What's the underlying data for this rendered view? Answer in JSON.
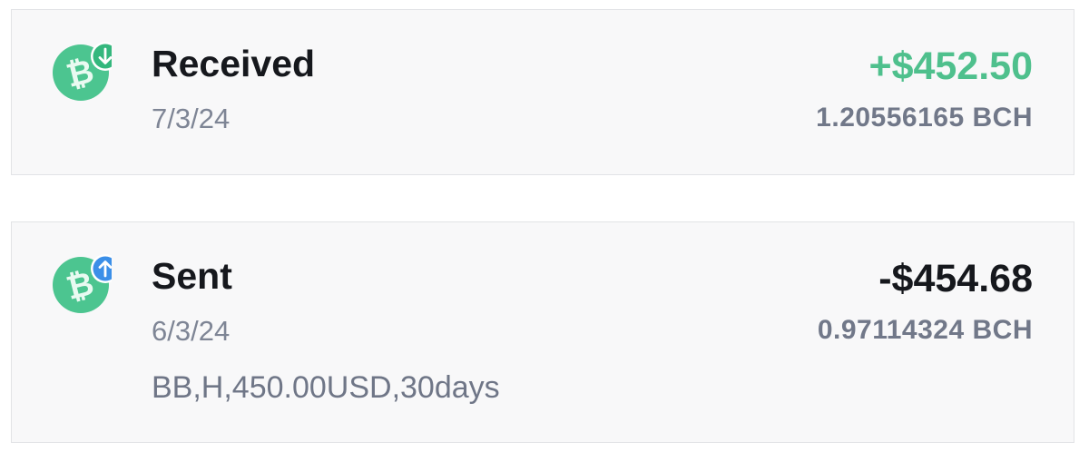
{
  "colors": {
    "positive": "#4fc08d",
    "negative": "#16181d",
    "coin": "#4cc590",
    "received_badge": "#34b77d",
    "sent_badge": "#3b8fe8"
  },
  "transactions": [
    {
      "type": "received",
      "icon": "bitcoin-cash-received-icon",
      "title": "Received",
      "date": "7/3/24",
      "amount": "+$452.50",
      "crypto_amount": "1.20556165 BCH"
    },
    {
      "type": "sent",
      "icon": "bitcoin-cash-sent-icon",
      "title": "Sent",
      "date": "6/3/24",
      "amount": "-$454.68",
      "crypto_amount": "0.97114324 BCH",
      "memo": "BB,H,450.00USD,30days"
    }
  ]
}
